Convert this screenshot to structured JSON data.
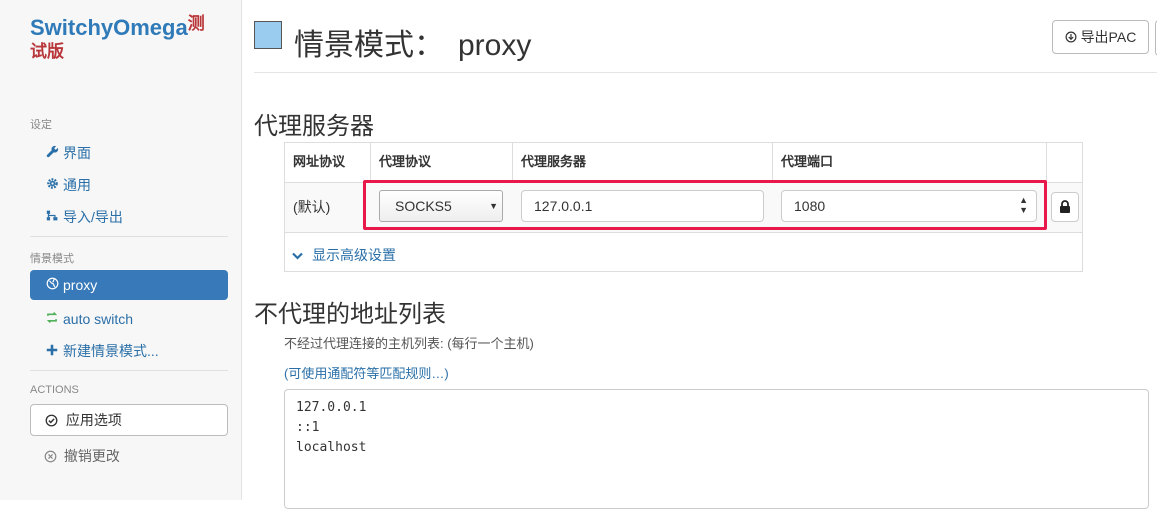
{
  "brand": {
    "name": "SwitchyOmega",
    "badge_top": "测",
    "badge_bottom": "试版"
  },
  "sidebar": {
    "settings_title": "设定",
    "settings_items": [
      {
        "label": "界面",
        "icon": "wrench-icon"
      },
      {
        "label": "通用",
        "icon": "gear-icon"
      },
      {
        "label": "导入/导出",
        "icon": "sitemap-icon"
      }
    ],
    "profiles_title": "情景模式",
    "profile_items": [
      {
        "label": "proxy",
        "icon": "globe-icon",
        "active": true
      },
      {
        "label": "auto switch",
        "icon": "refresh-icon"
      },
      {
        "label": "新建情景模式...",
        "icon": "plus-icon"
      }
    ],
    "actions_title": "ACTIONS",
    "apply_label": "应用选项",
    "discard_label": "撤销更改"
  },
  "header": {
    "title_prefix": "情景模式：",
    "profile_name": "proxy",
    "swatch_color": "#99ccee",
    "export_label": "导出PAC"
  },
  "proxy_servers": {
    "title": "代理服务器",
    "columns": [
      "网址协议",
      "代理协议",
      "代理服务器",
      "代理端口"
    ],
    "row": {
      "scheme": "(默认)",
      "protocol": "SOCKS5",
      "server": "127.0.0.1",
      "port": "1080"
    },
    "advanced_label": "显示高级设置"
  },
  "bypass": {
    "title": "不代理的地址列表",
    "note": "不经过代理连接的主机列表: (每行一个主机)",
    "rules_link": "(可使用通配符等匹配规则…)",
    "list": "127.0.0.1\n::1\nlocalhost"
  },
  "colors": {
    "accent": "#3779b9",
    "link": "#2a6fa8",
    "highlight": "#e8194a",
    "brand_badge": "#b9373a"
  }
}
